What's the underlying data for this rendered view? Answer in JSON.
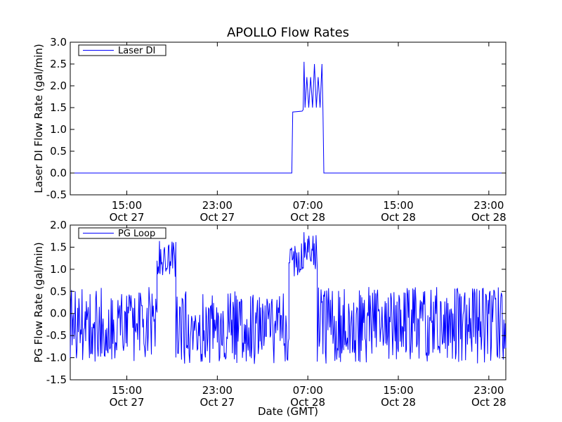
{
  "chart_data": {
    "title": "APOLLO Flow Rates",
    "xlabel": "Date (GMT)",
    "x_time_range": [
      "2010-10-27T10:00",
      "2010-10-29T00:30"
    ],
    "x_ticks": [
      {
        "time": "2010-10-27T15:00",
        "time_label": "15:00",
        "date_label": "Oct 27"
      },
      {
        "time": "2010-10-27T23:00",
        "time_label": "23:00",
        "date_label": "Oct 27"
      },
      {
        "time": "2010-10-28T07:00",
        "time_label": "07:00",
        "date_label": "Oct 28"
      },
      {
        "time": "2010-10-28T15:00",
        "time_label": "15:00",
        "date_label": "Oct 28"
      },
      {
        "time": "2010-10-28T23:00",
        "time_label": "23:00",
        "date_label": "Oct 28"
      }
    ],
    "panels": [
      {
        "type": "line",
        "ylabel": "Laser DI Flow Rate (gal/min)",
        "ylim": [
          -0.5,
          3.0
        ],
        "yticks": [
          -0.5,
          0.0,
          0.5,
          1.0,
          1.5,
          2.0,
          2.5,
          3.0
        ],
        "ytick_labels": [
          "-0.5",
          "0.0",
          "0.5",
          "1.0",
          "1.5",
          "2.0",
          "2.5",
          "3.0"
        ],
        "legend_placement": "upper-left",
        "color": "#0000ff",
        "series": [
          {
            "name": "Laser DI",
            "points": [
              {
                "time": "2010-10-27T10:00",
                "y": 0.0
              },
              {
                "time": "2010-10-28T05:35",
                "y": 0.0
              },
              {
                "time": "2010-10-28T05:40",
                "y": 1.4
              },
              {
                "time": "2010-10-28T06:30",
                "y": 1.42
              },
              {
                "time": "2010-10-28T06:35",
                "y": 1.45
              },
              {
                "time": "2010-10-28T06:40",
                "y": 2.55
              },
              {
                "time": "2010-10-28T06:45",
                "y": 1.5
              },
              {
                "time": "2010-10-28T06:55",
                "y": 2.2
              },
              {
                "time": "2010-10-28T07:05",
                "y": 1.5
              },
              {
                "time": "2010-10-28T07:15",
                "y": 2.2
              },
              {
                "time": "2010-10-28T07:25",
                "y": 1.5
              },
              {
                "time": "2010-10-28T07:35",
                "y": 2.5
              },
              {
                "time": "2010-10-28T07:45",
                "y": 1.5
              },
              {
                "time": "2010-10-28T07:55",
                "y": 2.2
              },
              {
                "time": "2010-10-28T08:05",
                "y": 1.5
              },
              {
                "time": "2010-10-28T08:15",
                "y": 2.5
              },
              {
                "time": "2010-10-28T08:20",
                "y": 1.45
              },
              {
                "time": "2010-10-28T08:25",
                "y": 0.0
              },
              {
                "time": "2010-10-29T00:30",
                "y": 0.0
              }
            ]
          }
        ]
      },
      {
        "type": "line",
        "ylabel": "PG Flow Rate (gal/min)",
        "ylim": [
          -1.5,
          2.0
        ],
        "yticks": [
          -1.5,
          -1.0,
          -0.5,
          0.0,
          0.5,
          1.0,
          1.5,
          2.0
        ],
        "ytick_labels": [
          "-1.5",
          "-1.0",
          "-0.5",
          "0.0",
          "0.5",
          "1.0",
          "1.5",
          "2.0"
        ],
        "legend_placement": "upper-left",
        "color": "#0000ff",
        "series": [
          {
            "name": "PG Loop",
            "segments": [
              {
                "start": "2010-10-27T10:00",
                "end": "2010-10-27T17:40",
                "low": -1.1,
                "high": 0.6,
                "points": 140
              },
              {
                "start": "2010-10-27T17:40",
                "end": "2010-10-27T19:20",
                "low": 0.8,
                "high": 1.65,
                "points": 30
              },
              {
                "start": "2010-10-27T19:20",
                "end": "2010-10-28T05:20",
                "low": -1.15,
                "high": 0.5,
                "points": 180
              },
              {
                "start": "2010-10-28T05:20",
                "end": "2010-10-28T06:30",
                "low": 0.8,
                "high": 1.6,
                "points": 20
              },
              {
                "start": "2010-10-28T06:30",
                "end": "2010-10-28T07:50",
                "low": 1.0,
                "high": 1.9,
                "points": 25
              },
              {
                "start": "2010-10-28T07:50",
                "end": "2010-10-29T00:30",
                "low": -1.15,
                "high": 0.6,
                "points": 300
              }
            ]
          }
        ]
      }
    ]
  }
}
